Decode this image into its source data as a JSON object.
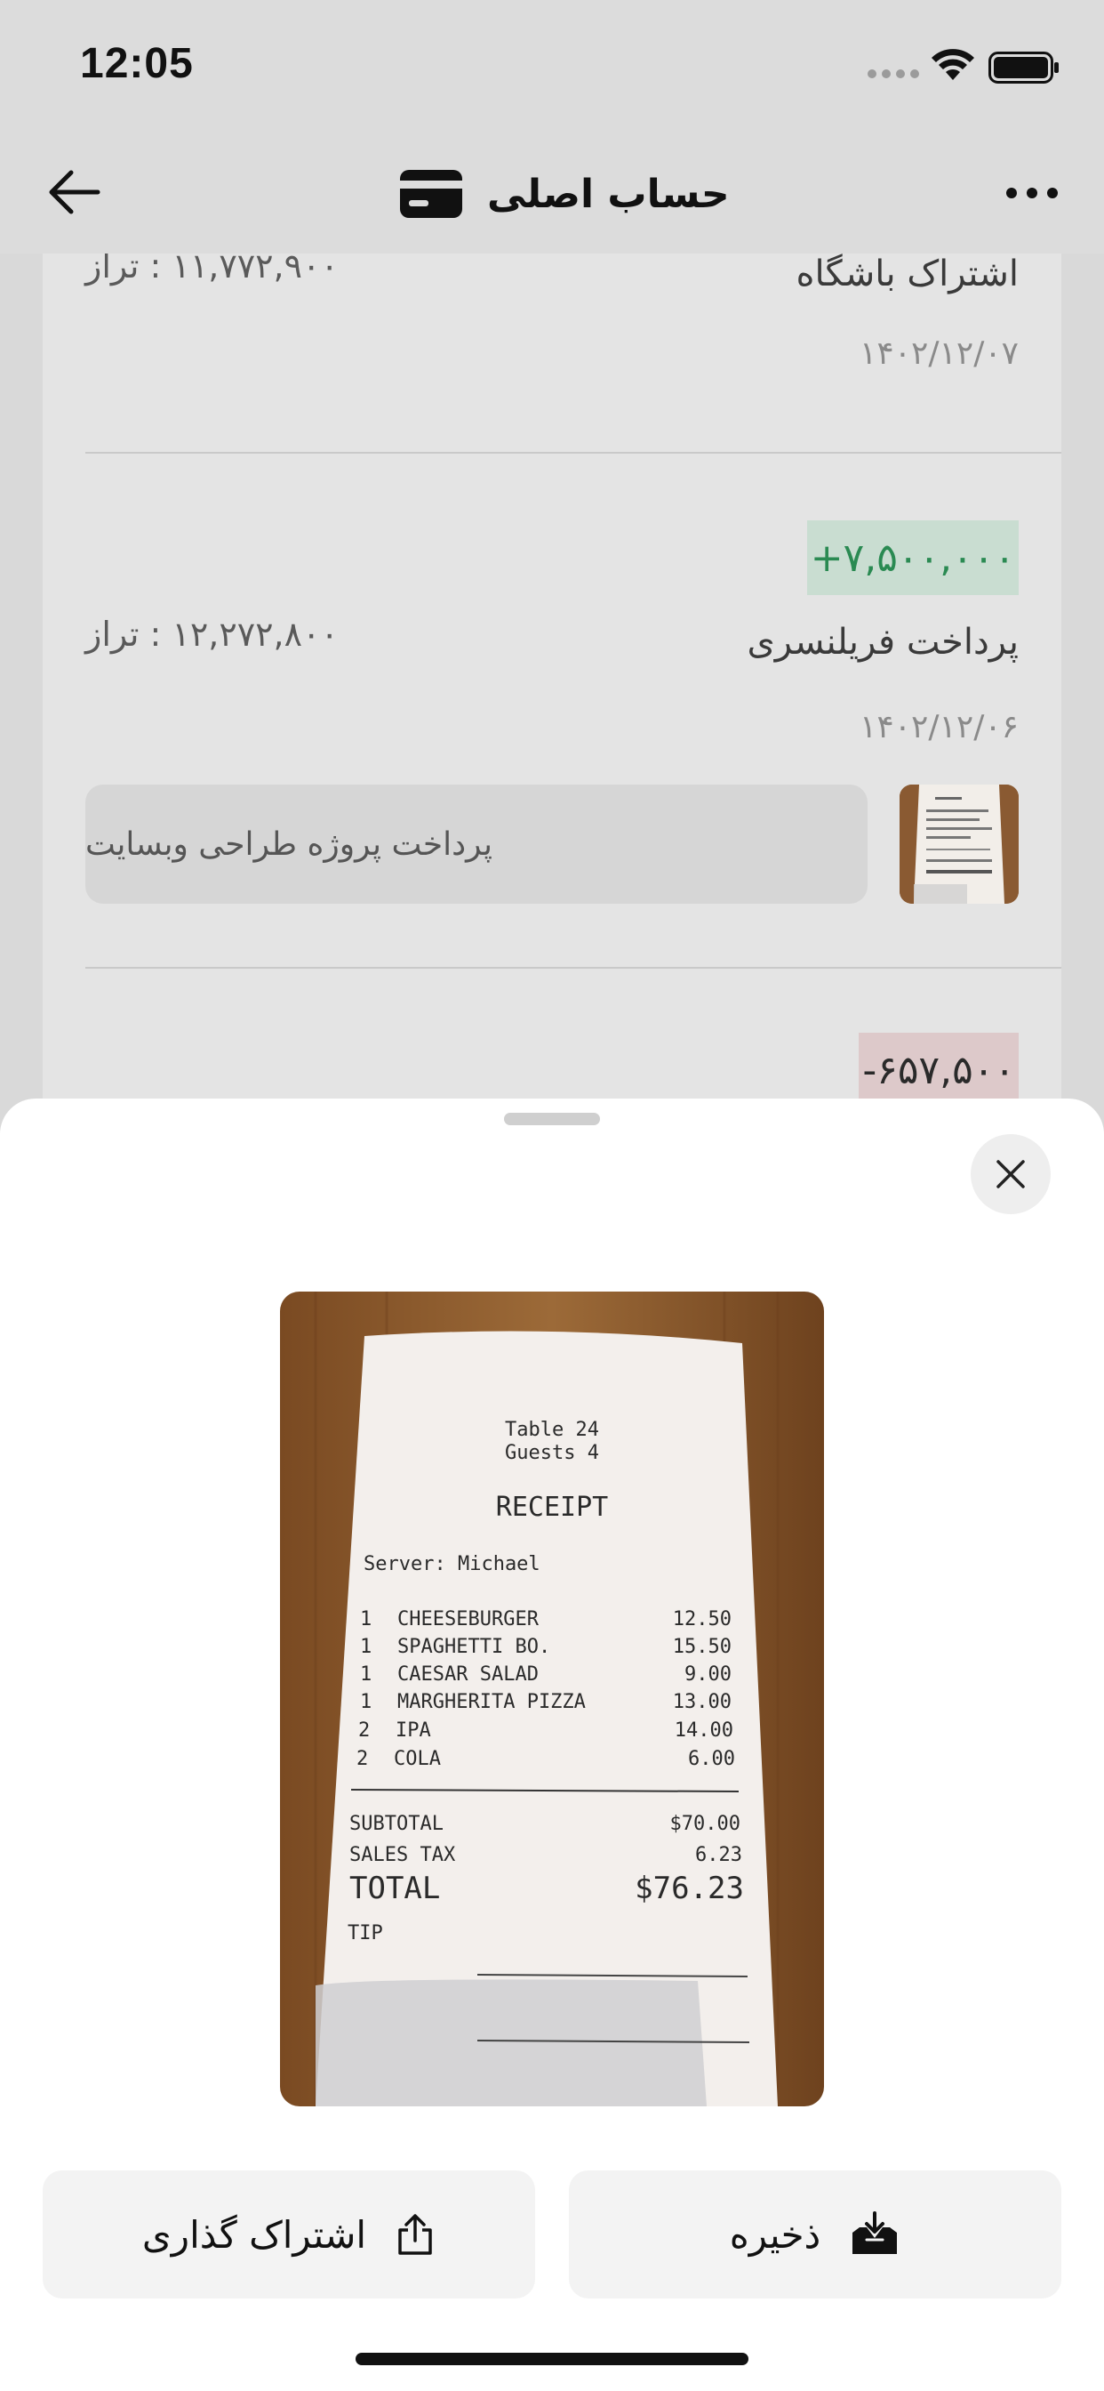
{
  "status_bar": {
    "time": "12:05",
    "icons": [
      "cellular-signal-icon",
      "wifi-icon",
      "battery-icon"
    ]
  },
  "nav": {
    "title": "حساب اصلی",
    "back_icon": "arrow-left-icon",
    "title_icon": "credit-card-icon",
    "more_icon": "more-horizontal-icon"
  },
  "transactions": [
    {
      "title": "اشتراک باشگاه",
      "date": "۱۴۰۲/۱۲/۰۷",
      "balance": "۱۱,۷۷۲,۹۰۰ : تراز"
    },
    {
      "amount": "+۷,۵۰۰,۰۰۰",
      "amount_type": "income",
      "title": "پرداخت فریلنسری",
      "date": "۱۴۰۲/۱۲/۰۶",
      "balance": "۱۲,۲۷۲,۸۰۰ : تراز",
      "note": "پرداخت پروژه طراحی وبسایت"
    },
    {
      "amount": "-۶۵۷,۵۰۰",
      "amount_type": "expense"
    }
  ],
  "colors": {
    "income_text": "#2a8a52",
    "income_bg": "#c9ddd1",
    "expense_bg": "#ddc9ca",
    "sheet_bg": "#ffffff",
    "button_bg": "#f3f3f3"
  },
  "sheet": {
    "close_icon": "close-icon",
    "receipt": {
      "header_lines": [
        "Table 24",
        "Guests 4"
      ],
      "title": "RECEIPT",
      "server": "Server: Michael",
      "items": [
        {
          "qty": "1",
          "name": "CHEESEBURGER",
          "price": "12.50"
        },
        {
          "qty": "1",
          "name": "SPAGHETTI BO.",
          "price": "15.50"
        },
        {
          "qty": "1",
          "name": "CAESAR SALAD",
          "price": "9.00"
        },
        {
          "qty": "1",
          "name": "MARGHERITA PIZZA",
          "price": "13.00"
        },
        {
          "qty": "2",
          "name": "IPA",
          "price": "14.00"
        },
        {
          "qty": "2",
          "name": "COLA",
          "price": "6.00"
        }
      ],
      "subtotal_label": "SUBTOTAL",
      "subtotal": "$70.00",
      "tax_label": "SALES TAX",
      "tax": "6.23",
      "total_label": "TOTAL",
      "total": "$76.23",
      "tip_label": "TIP"
    },
    "save_label": "ذخیره",
    "save_icon": "tray-download-icon",
    "share_label": "اشتراک گذاری",
    "share_icon": "share-icon"
  }
}
